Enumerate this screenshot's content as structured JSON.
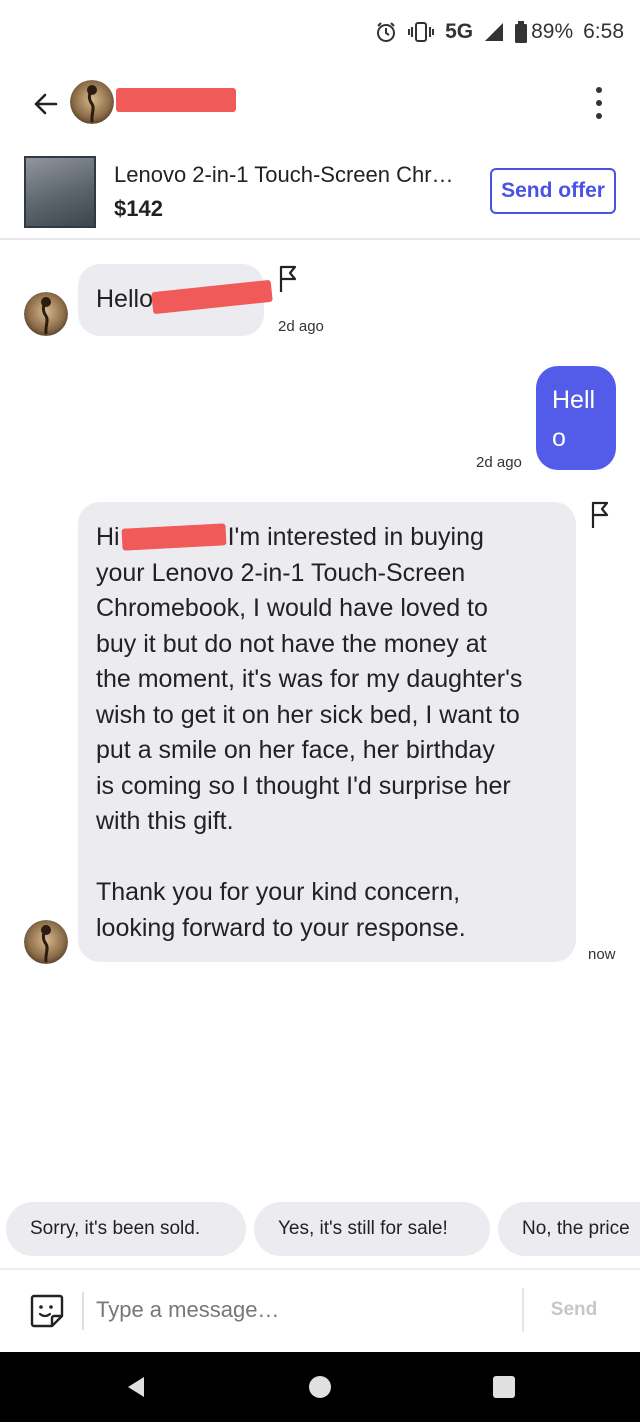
{
  "status_bar": {
    "network": "5G",
    "battery": "89%",
    "time": "6:58"
  },
  "header": {
    "icons": [
      "back-arrow-icon",
      "avatar",
      "more-vertical-icon"
    ]
  },
  "listing": {
    "title": "Lenovo 2-in-1 Touch-Screen Chr…",
    "price": "$142",
    "send_offer_label": "Send offer"
  },
  "messages": [
    {
      "direction": "incoming",
      "text": "Hello",
      "time": "2d ago"
    },
    {
      "direction": "outgoing",
      "lines": [
        "Hell",
        "o"
      ],
      "time": "2d ago"
    },
    {
      "direction": "incoming",
      "first_word": "Hi",
      "first_line_rest": "I'm interested in buying",
      "lines": [
        "your Lenovo 2-in-1 Touch-Screen",
        "Chromebook, I would have loved to",
        "buy it but do not have the money at",
        "the moment, it's was for my daughter's",
        "wish to get it on her sick bed, I want to",
        "put a smile on her face, her birthday",
        "is coming so I thought I'd surprise her",
        "with this gift."
      ],
      "closing_lines": [
        "Thank you for your kind concern,",
        "looking forward to your response."
      ],
      "time": "now"
    }
  ],
  "quick_replies": [
    "Sorry, it's been sold.",
    "Yes, it's still for sale!",
    "No, the price"
  ],
  "composer": {
    "placeholder": "Type a message…",
    "send_label": "Send"
  },
  "colors": {
    "accent": "#535ce8",
    "incoming_bubble": "#ececf0",
    "redaction": "#f05a58",
    "nav_bar": "#000000"
  }
}
